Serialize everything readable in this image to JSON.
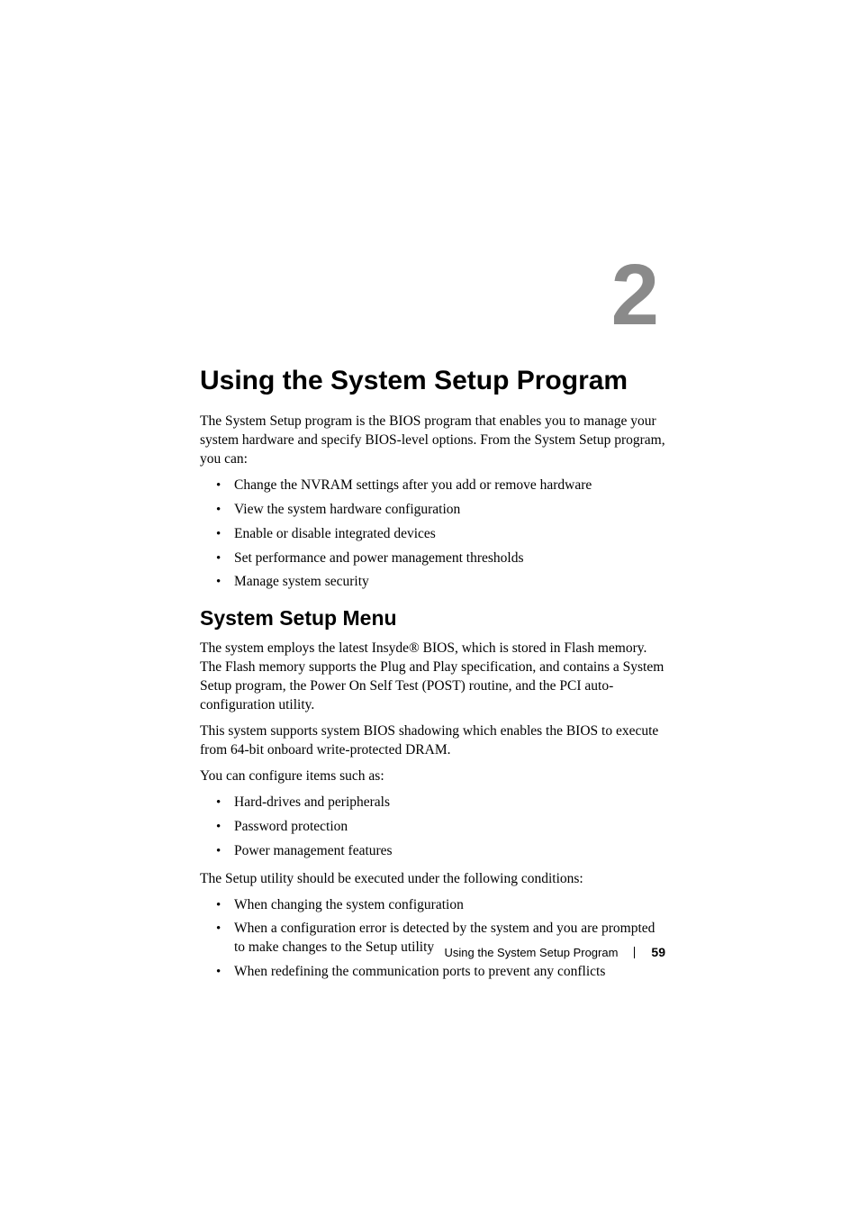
{
  "chapter": {
    "number": "2",
    "title": "Using the System Setup Program"
  },
  "intro": "The System Setup program is the BIOS program that enables you to manage your system hardware and specify BIOS-level options. From the System Setup program, you can:",
  "intro_bullets": [
    "Change the NVRAM settings after you add or remove hardware",
    "View the system hardware configuration",
    "Enable or disable integrated devices",
    "Set performance and power management thresholds",
    "Manage system security"
  ],
  "section": {
    "title": "System Setup Menu",
    "p1": "The system employs the latest Insyde® BIOS, which is stored in Flash memory. The Flash memory supports the Plug and Play specification, and contains a System Setup program, the Power On Self Test (POST) routine, and the PCI auto-configuration utility.",
    "p2": "This system supports system BIOS shadowing which enables the BIOS to execute from 64-bit onboard write-protected DRAM.",
    "p3": "You can configure items such as:",
    "bullets1": [
      "Hard-drives and peripherals",
      "Password protection",
      "Power management features"
    ],
    "p4": "The Setup utility should be executed under the following conditions:",
    "bullets2": [
      "When changing the system configuration",
      "When a configuration error is detected by the system and you are prompted to make changes to the Setup utility",
      "When redefining the communication ports to prevent any conflicts"
    ]
  },
  "footer": {
    "label": "Using the System Setup Program",
    "page": "59"
  }
}
